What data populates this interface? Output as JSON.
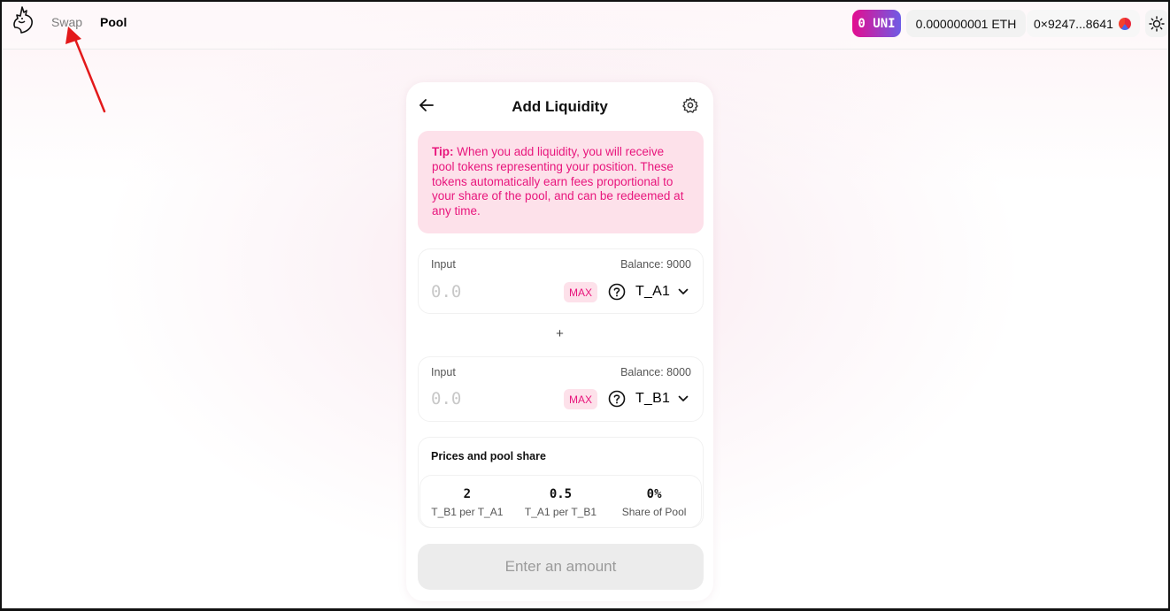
{
  "nav": {
    "swap_label": "Swap",
    "pool_label": "Pool"
  },
  "header": {
    "uni_badge": "0 UNI",
    "eth_balance": "0.000000001 ETH",
    "address": "0×9247...8641"
  },
  "card": {
    "title": "Add Liquidity",
    "tip_prefix": "Tip:",
    "tip_text": " When you add liquidity, you will receive pool tokens representing your position. These tokens automatically earn fees proportional to your share of the pool, and can be redeemed at any time.",
    "plus_sign": "+",
    "input_a": {
      "label": "Input",
      "balance": "Balance: 9000",
      "value": "0.0",
      "max_label": "MAX",
      "token": "T_A1"
    },
    "input_b": {
      "label": "Input",
      "balance": "Balance: 8000",
      "value": "0.0",
      "max_label": "MAX",
      "token": "T_B1"
    },
    "prices": {
      "title": "Prices and pool share",
      "items": [
        {
          "value": "2",
          "label": "T_B1 per T_A1"
        },
        {
          "value": "0.5",
          "label": "T_A1 per T_B1"
        },
        {
          "value": "0%",
          "label": "Share of Pool"
        }
      ]
    },
    "submit_label": "Enter an amount"
  },
  "colors": {
    "accent_pink": "#e8157c",
    "tip_bg": "#fde1ea",
    "annotation_red": "#e3191b"
  },
  "icons": {
    "logo": "unicorn-logo-icon",
    "back": "arrow-left-icon",
    "settings": "gear-icon",
    "token": "question-circle-icon",
    "chevron": "chevron-down-icon",
    "theme": "sun-icon",
    "avatar": "identicon-icon"
  }
}
